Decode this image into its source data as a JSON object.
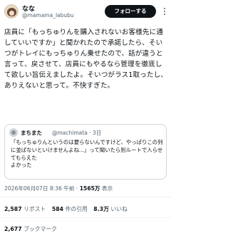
{
  "author": {
    "display_name": "なな",
    "handle": "@mamama_labubu",
    "follow_label": "フォローする",
    "more_icon": "more-horizontal-icon"
  },
  "tweet": {
    "text": "店員に「もっちゅりんを購入されないお客様先に通していいですか」と聞かれたので承諾したら、そいつがトレイにもっちゅりん乗せたので、話が違うと言って、戻させて、店員にもやるなら管理を徹底して欲しい旨伝えましたよ。そいつがラス1取ったし、ありえないと思って。不快すぎた。"
  },
  "quote": {
    "display_name": "まちまた",
    "handle_meta": "@machimata · 3日",
    "text": "「もっちゅりんというのは要らないんですけど、やっぱりこの列に並ばないといけませんよね...」って聞いたら別ルートで入らせてもらえた\nよかった"
  },
  "meta": {
    "timestamp": "2026年06月07日 8:36 午前 · ",
    "views_count": "1565万",
    "views_label": " 表示"
  },
  "stats": {
    "reposts_count": "2,587",
    "reposts_label": " リポスト",
    "quotes_count": "584",
    "quotes_label": " 件の引用",
    "likes_count": "8.3万",
    "likes_label": " いいね",
    "bookmarks_count": "2,677",
    "bookmarks_label": " ブックマーク"
  }
}
